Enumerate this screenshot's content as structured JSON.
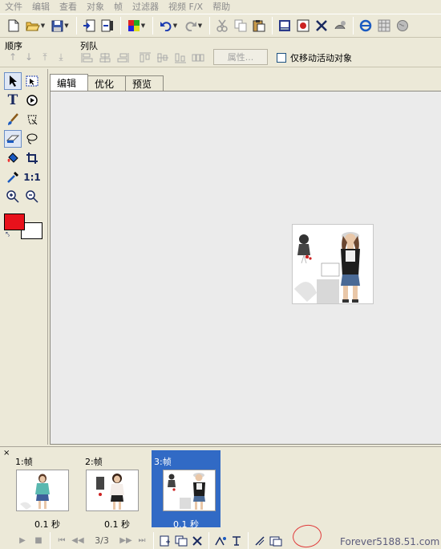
{
  "menu": [
    "文件",
    "编辑",
    "查看",
    "对象",
    "帧",
    "过滤器",
    "视频 F/X",
    "帮助"
  ],
  "toolbar": {
    "groups": [
      [
        "new-icon",
        "open-icon",
        "save-icon"
      ],
      [
        "import-icon",
        "export-icon"
      ],
      [
        "palette-icon"
      ],
      [
        "undo-icon",
        "redo-icon"
      ],
      [
        "cut-icon",
        "copy-icon",
        "paste-icon"
      ],
      [
        "crop-canvas-icon",
        "resize-icon",
        "trim-icon",
        "fit-icon"
      ],
      [
        "ie-preview-icon",
        "grid-icon",
        "globe-icon"
      ]
    ]
  },
  "toolbar2": {
    "order_label": "顺序",
    "align_label": "列队",
    "properties_button": "属性...",
    "move_active_only_label": "仅移动活动对象"
  },
  "tools": [
    [
      "pointer-tool",
      "marquee-tool"
    ],
    [
      "text-tool",
      "preset-shape-tool"
    ],
    [
      "paintbrush-tool",
      "lasso-tool"
    ],
    [
      "eraser-tool",
      "freehand-lasso-tool"
    ],
    [
      "fill-tool",
      "crop-tool"
    ],
    [
      "eyedropper-tool",
      "actual-size-tool"
    ],
    [
      "zoom-in-tool",
      "zoom-out-tool"
    ]
  ],
  "colors": {
    "foreground": "#e8111b",
    "background": "#ffffff",
    "selection": "#316ac5",
    "highlight": "#e03a3a"
  },
  "tabs": [
    "编辑",
    "优化",
    "预览"
  ],
  "frames": [
    {
      "label": "1:帧",
      "delay": "0.1 秒"
    },
    {
      "label": "2:帧",
      "delay": "0.1 秒"
    },
    {
      "label": "3:帧",
      "delay": "0.1 秒"
    }
  ],
  "frame_counter": "3/3",
  "watermark": "Forever5188.51.com"
}
